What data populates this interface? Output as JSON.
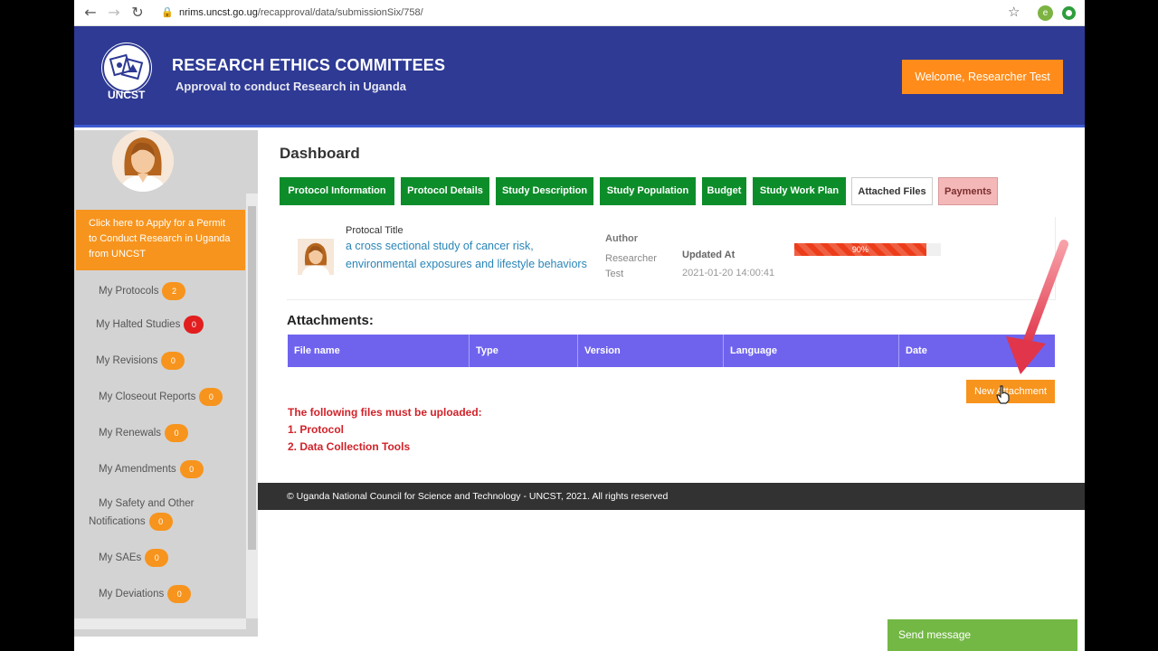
{
  "browser": {
    "url_prefix": "nrims.uncst.go.ug",
    "url_path": "/recapproval/data/submissionSix/758/",
    "profile_initial": "e"
  },
  "header": {
    "logo_text": "UNCST",
    "title": "RESEARCH ETHICS COMMITTEES",
    "subtitle": "Approval to conduct Research in Uganda",
    "welcome": "Welcome, Researcher Test",
    "bg_color": "#2e3a94"
  },
  "sidebar": {
    "permit_text": "Click here to Apply for a Permit to Conduct Research in Uganda from UNCST",
    "items": [
      {
        "label": "My Protocols",
        "count": "2"
      },
      {
        "label": "My Halted Studies",
        "count": "0"
      },
      {
        "label": "My Revisions",
        "count": "0"
      },
      {
        "label": "My Closeout Reports",
        "count": "0"
      },
      {
        "label": "My Renewals",
        "count": "0"
      },
      {
        "label": "My Amendments",
        "count": "0"
      },
      {
        "label": "My Safety and Other Notifications",
        "count": "0"
      },
      {
        "label": "My SAEs",
        "count": "0"
      },
      {
        "label": "My Deviations",
        "count": "0"
      }
    ]
  },
  "main": {
    "page_title": "Dashboard",
    "tabs": [
      {
        "label": "Protocol Information"
      },
      {
        "label": "Protocol Details"
      },
      {
        "label": "Study Description"
      },
      {
        "label": "Study Population"
      },
      {
        "label": "Budget"
      },
      {
        "label": "Study Work Plan"
      },
      {
        "label": "Attached Files"
      },
      {
        "label": "Payments"
      }
    ],
    "protocol": {
      "title_label": "Protocal Title",
      "title": "a cross sectional study of cancer risk, environmental exposures and lifestyle behaviors",
      "author_label": "Author",
      "author": "Researcher Test",
      "updated_label": "Updated At",
      "updated_value": "2021-01-20 14:00:41",
      "progress_label": "90%",
      "progress_fraction": 0.9
    },
    "attachments": {
      "heading": "Attachments:",
      "columns": [
        "File name",
        "Type",
        "Version",
        "Language",
        "Date"
      ],
      "new_button": "New Attachment"
    },
    "required": {
      "title": "The following files must be uploaded:",
      "items": [
        "1. Protocol",
        "2. Data Collection Tools"
      ]
    }
  },
  "footer": {
    "text": "© Uganda National Council for Science and Technology - UNCST, 2021. All rights reserved"
  },
  "chat": {
    "send_label": "Send message"
  },
  "colors": {
    "tab_green": "#0d8d2a",
    "accent_orange": "#f7941d",
    "table_purple": "#6f63ee",
    "alert_red": "#d0232a"
  }
}
